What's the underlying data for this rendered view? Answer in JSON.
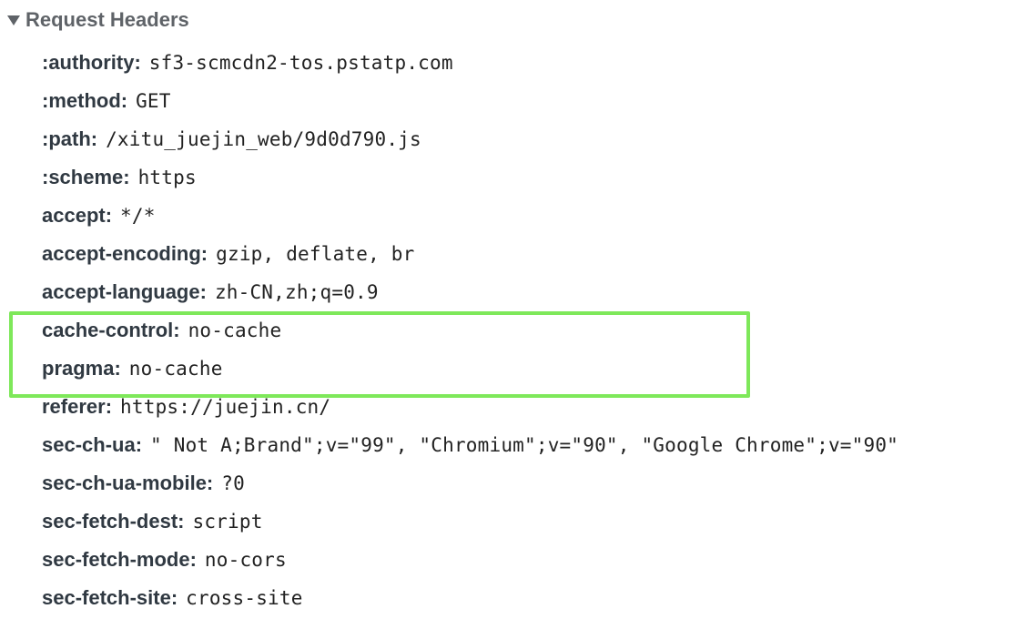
{
  "section": {
    "title": "Request Headers",
    "expanded": true,
    "icon": "triangle-down-icon"
  },
  "headers": [
    {
      "name": ":authority:",
      "value": "sf3-scmcdn2-tos.pstatp.com"
    },
    {
      "name": ":method:",
      "value": "GET"
    },
    {
      "name": ":path:",
      "value": "/xitu_juejin_web/9d0d790.js"
    },
    {
      "name": ":scheme:",
      "value": "https"
    },
    {
      "name": "accept:",
      "value": "*/*"
    },
    {
      "name": "accept-encoding:",
      "value": "gzip, deflate, br"
    },
    {
      "name": "accept-language:",
      "value": "zh-CN,zh;q=0.9"
    },
    {
      "name": "cache-control:",
      "value": "no-cache"
    },
    {
      "name": "pragma:",
      "value": "no-cache"
    },
    {
      "name": "referer:",
      "value": "https://juejin.cn/"
    },
    {
      "name": "sec-ch-ua:",
      "value": "\" Not A;Brand\";v=\"99\", \"Chromium\";v=\"90\", \"Google Chrome\";v=\"90\""
    },
    {
      "name": "sec-ch-ua-mobile:",
      "value": "?0"
    },
    {
      "name": "sec-fetch-dest:",
      "value": "script"
    },
    {
      "name": "sec-fetch-mode:",
      "value": "no-cors"
    },
    {
      "name": "sec-fetch-site:",
      "value": "cross-site"
    }
  ],
  "highlight": {
    "color": "#7ee85a",
    "rows": [
      "cache-control:",
      "pragma:"
    ]
  }
}
